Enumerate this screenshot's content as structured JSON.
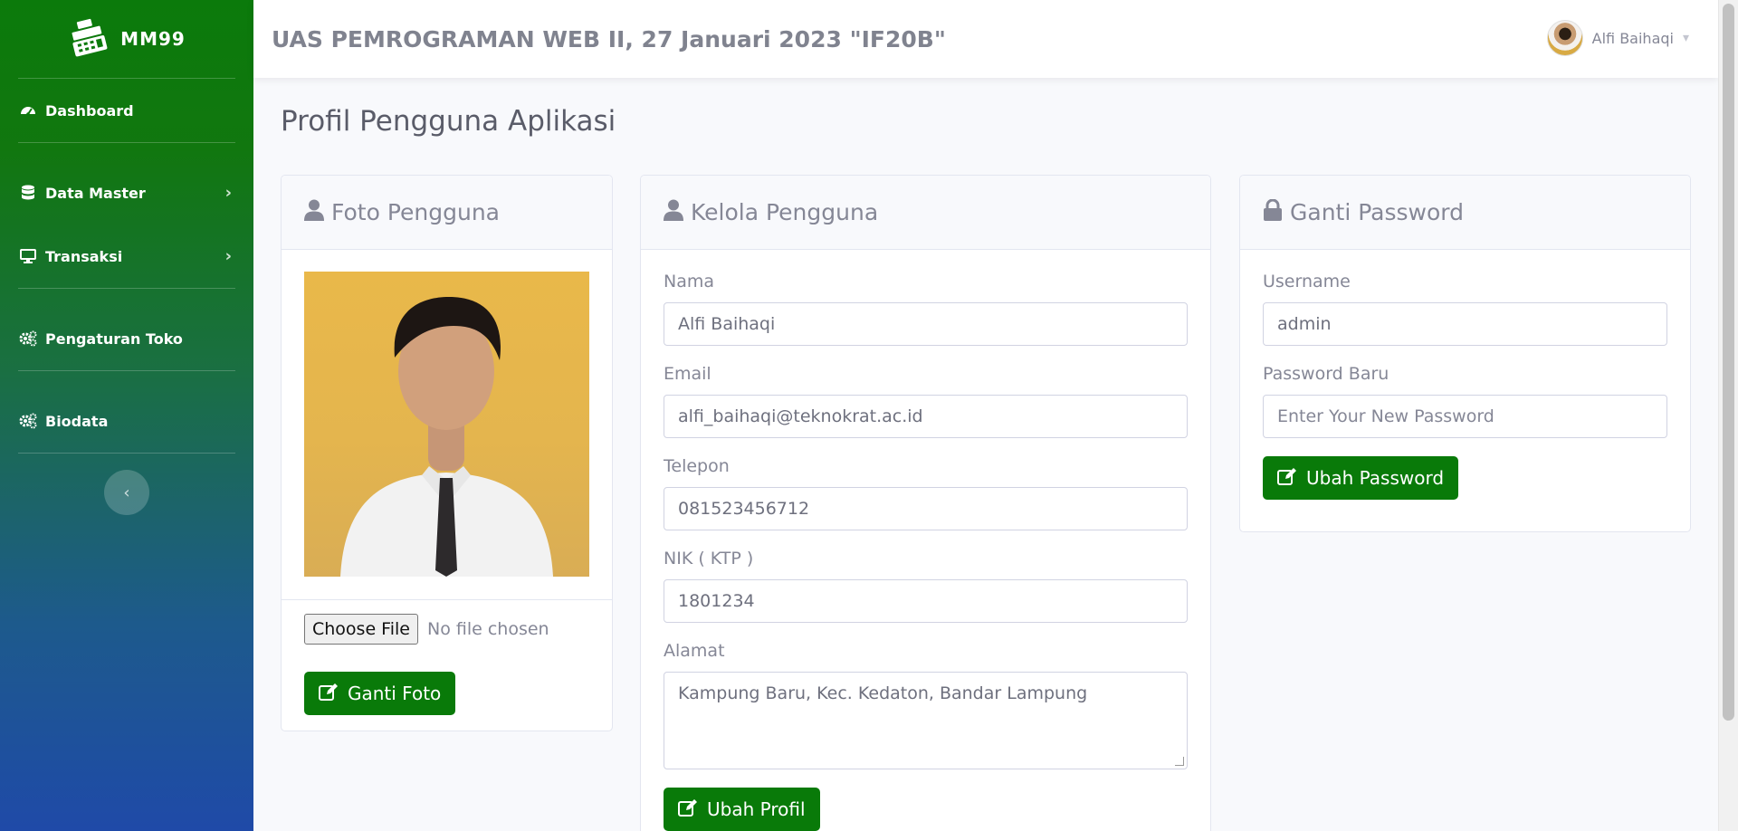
{
  "brand": {
    "name": "MM99"
  },
  "sidebar": {
    "items": [
      {
        "label": "Dashboard",
        "icon": "dashboard-icon"
      },
      {
        "label": "Data Master",
        "icon": "database-icon"
      },
      {
        "label": "Transaksi",
        "icon": "desktop-icon"
      },
      {
        "label": "Pengaturan Toko",
        "icon": "cogs-icon"
      },
      {
        "label": "Biodata",
        "icon": "cogs-icon"
      }
    ]
  },
  "topbar": {
    "title": "UAS PEMROGRAMAN WEB II, 27 Januari 2023 \"IF20B\""
  },
  "user": {
    "name": "Alfi Baihaqi"
  },
  "page": {
    "heading": "Profil Pengguna Aplikasi"
  },
  "photo_card": {
    "title": "Foto Pengguna",
    "choose_label": "Choose File",
    "no_file": "No file chosen",
    "button": "Ganti Foto"
  },
  "profile_card": {
    "title": "Kelola Pengguna",
    "fields": {
      "nama_label": "Nama",
      "nama_value": "Alfi Baihaqi",
      "email_label": "Email",
      "email_value": "alfi_baihaqi@teknokrat.ac.id",
      "telepon_label": "Telepon",
      "telepon_value": "081523456712",
      "nik_label": "NIK ( KTP )",
      "nik_value": "1801234",
      "alamat_label": "Alamat",
      "alamat_value": "Kampung Baru, Kec. Kedaton, Bandar Lampung"
    },
    "button": "Ubah Profil"
  },
  "password_card": {
    "title": "Ganti Password",
    "username_label": "Username",
    "username_value": "admin",
    "password_label": "Password Baru",
    "password_placeholder": "Enter Your New Password",
    "button": "Ubah Password"
  },
  "colors": {
    "primary_green": "#097a09",
    "sidebar_top": "#0b7a0b",
    "sidebar_bottom": "#1f4aa8"
  }
}
